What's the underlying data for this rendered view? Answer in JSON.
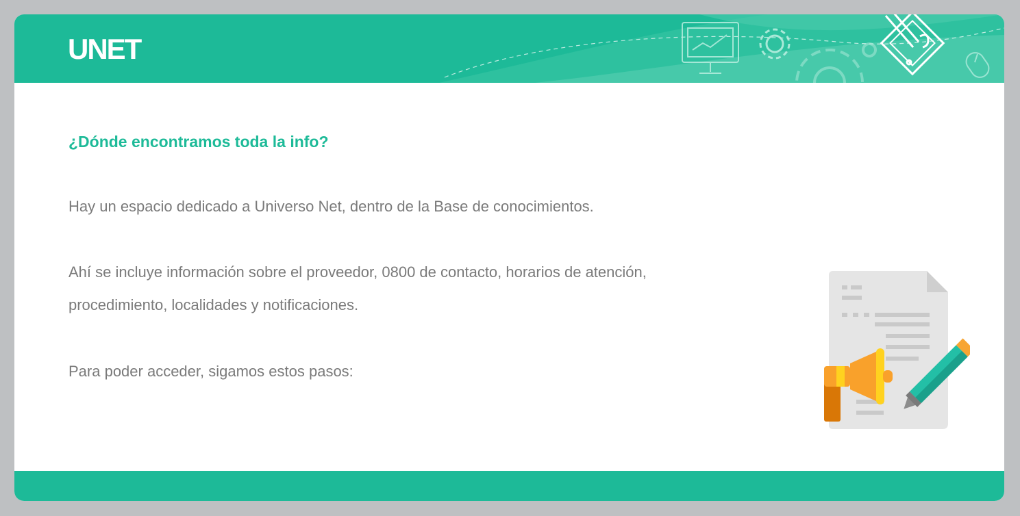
{
  "header": {
    "logo_text": "UNET"
  },
  "main": {
    "heading": "¿Dónde encontramos toda la info?",
    "paragraph_1": "Hay un espacio dedicado a Universo Net, dentro de la Base de conocimientos.",
    "paragraph_2_line_1": "Ahí se incluye información sobre el proveedor, 0800 de contacto, horarios de atención,",
    "paragraph_2_line_2": "procedimiento, localidades y notificaciones.",
    "paragraph_3": "Para poder acceder, sigamos estos pasos:"
  },
  "icons": [
    "presentation-icon",
    "gear-icon",
    "pencil-puzzle-icon",
    "mouse-icon",
    "document-megaphone-pencil-icon"
  ],
  "colors": {
    "accent": "#1dba98",
    "text": "#7a7a7a",
    "frame": "#bec0c2"
  }
}
